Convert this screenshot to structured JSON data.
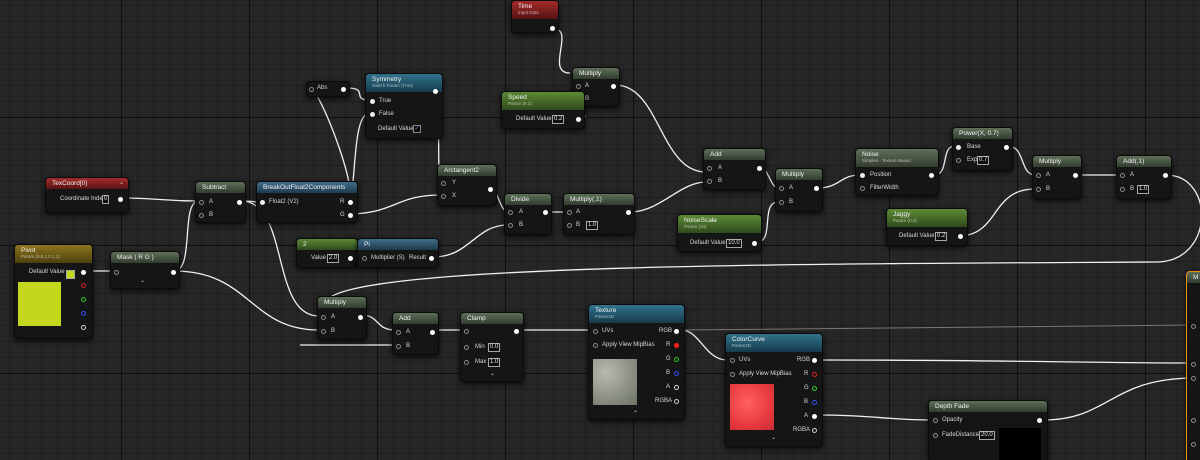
{
  "colors": {
    "wire": "#f0f0f0",
    "pivot_swatch": "#c3d81b",
    "selection_outline": "#f09010"
  },
  "nodes": {
    "time": {
      "title": "Time",
      "sub": "Input Data"
    },
    "multiply_a": {
      "title": "Multiply",
      "in1": "A",
      "in2": "B"
    },
    "speed": {
      "title": "Speed",
      "sub": "Param (0.2)",
      "label": "Default Value",
      "value": "0.2"
    },
    "abs": {
      "title": "Abs"
    },
    "symmetry": {
      "title": "Symmetry",
      "sub": "Switch Param (True)",
      "in1": "True",
      "in2": "False",
      "label": "Default Value"
    },
    "texcoord": {
      "title": "TexCoord[0]",
      "label": "Coordinate Index",
      "value": "0"
    },
    "subtract": {
      "title": "Subtract",
      "in1": "A",
      "in2": "B"
    },
    "breakout": {
      "title": "BreakOutFloat2Components",
      "in": "Float2 (V2)",
      "out1": "R",
      "out2": "G"
    },
    "arctangent": {
      "title": "Arctangent2",
      "in1": "Y",
      "in2": "X"
    },
    "divide": {
      "title": "Divide",
      "in1": "A",
      "in2": "B"
    },
    "multiply_b": {
      "title": "Multiply(,1)",
      "in1": "A",
      "in2": "B",
      "value": "1.0"
    },
    "add_a": {
      "title": "Add",
      "in1": "A",
      "in2": "B"
    },
    "multiply_c": {
      "title": "Multiply",
      "in1": "A",
      "in2": "B"
    },
    "noise": {
      "title": "Noise",
      "sub": "Simplex - Texture Based",
      "in1": "Position",
      "in2": "FilterWidth"
    },
    "power": {
      "title": "Power(X, 0.7)",
      "in1": "Base",
      "in2": "Exp",
      "value": "0.7"
    },
    "multiply_d": {
      "title": "Multiply",
      "in1": "A",
      "in2": "B"
    },
    "add_b": {
      "title": "Add(,1)",
      "in1": "A",
      "in2": "B",
      "value": "1.0"
    },
    "noisescale": {
      "title": "NoiseScale",
      "sub": "Param (10)",
      "label": "Default Value",
      "value": "10.0"
    },
    "jaggy": {
      "title": "Jaggy",
      "sub": "Param (0.2)",
      "label": "Default Value",
      "value": "0.2"
    },
    "pivot": {
      "title": "Pivot",
      "sub": "Param (0.8,1,0.1,1)",
      "label": "Default Value"
    },
    "mask": {
      "title": "Mask ( R G )"
    },
    "const2": {
      "title": "2",
      "label": "Value",
      "value": "2.0"
    },
    "pi": {
      "title": "Pi",
      "in": "Multiplier (S)",
      "out": "Result"
    },
    "multiply_e": {
      "title": "Multiply",
      "in1": "A",
      "in2": "B"
    },
    "add_c": {
      "title": "Add",
      "in1": "A",
      "in2": "B"
    },
    "clamp": {
      "title": "Clamp",
      "min_label": "Min",
      "min": "0.0",
      "max_label": "Max",
      "max": "1.0"
    },
    "texture": {
      "title": "Texture",
      "sub": "Param2D",
      "in1": "UVs",
      "in2": "Apply View MipBias",
      "o1": "RGB",
      "o2": "R",
      "o3": "G",
      "o4": "B",
      "o5": "A",
      "o6": "RGBA"
    },
    "colorcurve": {
      "title": "ColorCurve",
      "sub": "Param2D",
      "in1": "UVs",
      "in2": "Apply View MipBias",
      "o1": "RGB",
      "o2": "R",
      "o3": "G",
      "o4": "B",
      "o5": "A",
      "o6": "RGBA"
    },
    "depthfade": {
      "title": "Depth Fade",
      "in1": "Opacity",
      "in2": "FadeDistance",
      "value": "20.0"
    },
    "result": {
      "title": "M"
    }
  }
}
